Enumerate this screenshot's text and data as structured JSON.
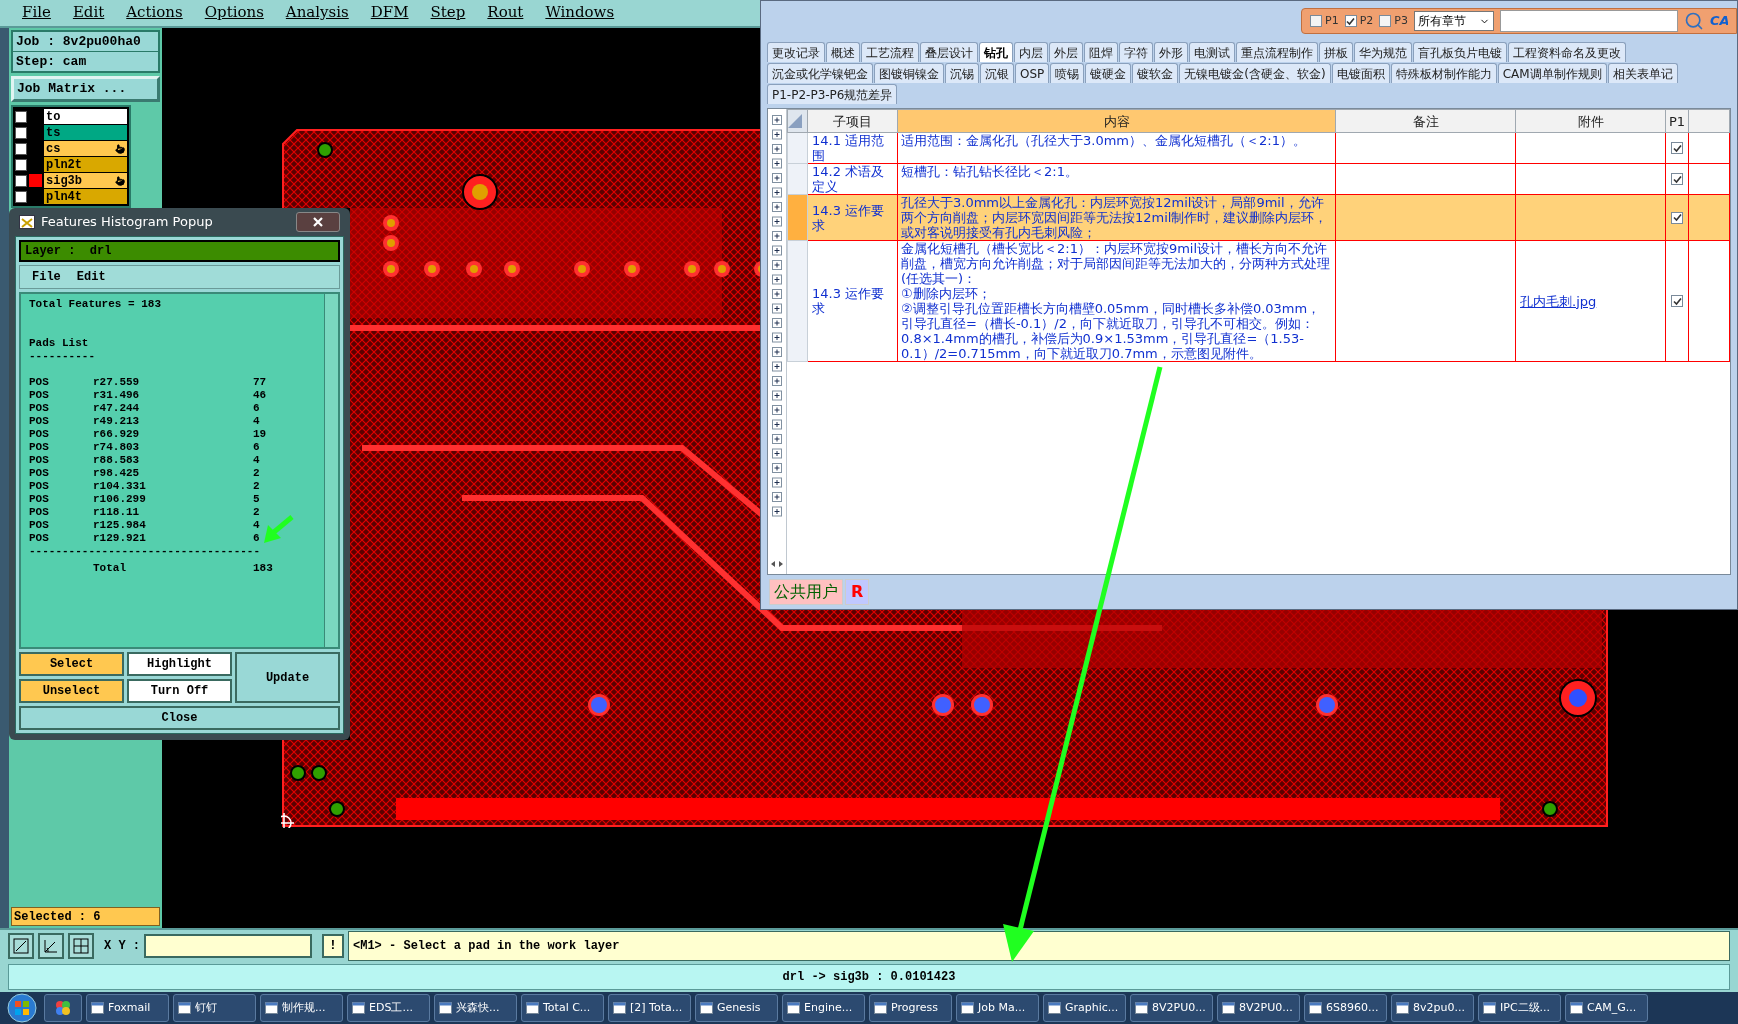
{
  "menu": [
    "File",
    "Edit",
    "Actions",
    "Options",
    "Analysis",
    "DFM",
    "Step",
    "Rout",
    "Windows"
  ],
  "job": {
    "job_label": "Job : 8v2pu00ha0",
    "step_label": "Step: cam",
    "matrix_button": "Job Matrix ..."
  },
  "layers": [
    {
      "name": "to",
      "color": "#ffffff",
      "checked": false,
      "work": false,
      "affected": false
    },
    {
      "name": "ts",
      "color": "#00a884",
      "checked": false,
      "work": false,
      "affected": false
    },
    {
      "name": "cs",
      "color": "#ffc850",
      "checked": false,
      "work": false,
      "affected": true
    },
    {
      "name": "pln2t",
      "color": "#d9a800",
      "checked": false,
      "work": false,
      "affected": false
    },
    {
      "name": "sig3b",
      "color": "#ffc850",
      "checked": false,
      "work": true,
      "affected": true
    },
    {
      "name": "pln4t",
      "color": "#d9a800",
      "checked": false,
      "work": false,
      "affected": false
    }
  ],
  "selected_label": "Selected : 6",
  "histogram": {
    "title": "Features Histogram Popup",
    "layer_label": "Layer :  drl",
    "menu": [
      "File",
      "Edit"
    ],
    "total_line": "Total Features = 183",
    "section": "Pads List",
    "underline": "----------",
    "pads": [
      {
        "polarity": "POS",
        "symbol": "r27.559",
        "count": "77"
      },
      {
        "polarity": "POS",
        "symbol": "r31.496",
        "count": "46"
      },
      {
        "polarity": "POS",
        "symbol": "r47.244",
        "count": "6"
      },
      {
        "polarity": "POS",
        "symbol": "r49.213",
        "count": "4"
      },
      {
        "polarity": "POS",
        "symbol": "r66.929",
        "count": "19"
      },
      {
        "polarity": "POS",
        "symbol": "r74.803",
        "count": "6"
      },
      {
        "polarity": "POS",
        "symbol": "r88.583",
        "count": "4"
      },
      {
        "polarity": "POS",
        "symbol": "r98.425",
        "count": "2"
      },
      {
        "polarity": "POS",
        "symbol": "r104.331",
        "count": "2"
      },
      {
        "polarity": "POS",
        "symbol": "r106.299",
        "count": "5"
      },
      {
        "polarity": "POS",
        "symbol": "r118.11",
        "count": "2"
      },
      {
        "polarity": "POS",
        "symbol": "r125.984",
        "count": "4"
      },
      {
        "polarity": "POS",
        "symbol": "r129.921",
        "count": "6"
      }
    ],
    "separator": "-----------------------------------",
    "total_label": "Total",
    "total_count": "183",
    "buttons": {
      "select": "Select",
      "unselect": "Unselect",
      "highlight": "Highlight",
      "turn_off": "Turn Off",
      "update": "Update",
      "close": "Close"
    }
  },
  "bottom": {
    "xy_label": "X Y :",
    "bang_button": "!",
    "message": "<M1> - Select a pad in the work layer",
    "status": "drl -> sig3b : 0.0101423"
  },
  "doc": {
    "filters": [
      {
        "label": "P1",
        "checked": false
      },
      {
        "label": "P2",
        "checked": true
      },
      {
        "label": "P3",
        "checked": false
      }
    ],
    "chapter_select": "所有章节",
    "logo_text": "CA",
    "tab_rows": [
      [
        {
          "label": "更改记录",
          "selected": false
        },
        {
          "label": "概述",
          "selected": false
        },
        {
          "label": "工艺流程",
          "selected": false
        },
        {
          "label": "叠层设计",
          "selected": false
        },
        {
          "label": "钻孔",
          "selected": true
        },
        {
          "label": "内层",
          "selected": false
        },
        {
          "label": "外层",
          "selected": false
        },
        {
          "label": "阻焊",
          "selected": false
        },
        {
          "label": "字符",
          "selected": false
        },
        {
          "label": "外形",
          "selected": false
        },
        {
          "label": "电测试",
          "selected": false
        },
        {
          "label": "重点流程制作",
          "selected": false
        },
        {
          "label": "拼板",
          "selected": false
        },
        {
          "label": "华为规范",
          "selected": false
        },
        {
          "label": "盲孔板负片电镀",
          "selected": false
        },
        {
          "label": "工程资料命名及更改",
          "selected": false
        }
      ],
      [
        {
          "label": "沉金或化学镍钯金",
          "selected": false
        },
        {
          "label": "图镀铜镍金",
          "selected": false
        },
        {
          "label": "沉锡",
          "selected": false
        },
        {
          "label": "沉银",
          "selected": false
        },
        {
          "label": "OSP",
          "selected": false
        },
        {
          "label": "喷锡",
          "selected": false
        },
        {
          "label": "镀硬金",
          "selected": false
        },
        {
          "label": "镀软金",
          "selected": false
        },
        {
          "label": "无镍电镀金(含硬金、软金)",
          "selected": false
        },
        {
          "label": "电镀面积",
          "selected": false
        },
        {
          "label": "特殊板材制作能力",
          "selected": false
        },
        {
          "label": "CAM调单制作规则",
          "selected": false
        },
        {
          "label": "相关表单记",
          "selected": false
        }
      ],
      [
        {
          "label": "P1-P2-P3-P6规范差异",
          "selected": false
        }
      ]
    ],
    "table": {
      "columns": [
        "子项目",
        "内容",
        "备注",
        "附件",
        "P1"
      ],
      "rows": [
        {
          "item": "14.1 适用范围",
          "content": "适用范围：金属化孔（孔径大于3.0mm）、金属化短槽孔（＜2:1）。",
          "attachment": null,
          "p1": true,
          "selected": false
        },
        {
          "item": "14.2 术语及定义",
          "content": "短槽孔：钻孔钻长径比＜2:1。",
          "attachment": null,
          "p1": true,
          "selected": false
        },
        {
          "item": "14.3 运作要求",
          "content": "孔径大于3.0mm以上金属化孔：内层环宽按12mil设计，局部9mil，允许两个方向削盘；内层环宽因间距等无法按12mil制作时，建议删除内层环，或对客说明接受有孔内毛刺风险；",
          "attachment": null,
          "p1": true,
          "selected": true
        },
        {
          "item": "14.3 运作要求",
          "content": "金属化短槽孔（槽长宽比＜2:1）：内层环宽按9mil设计，槽长方向不允许削盘，槽宽方向允许削盘；对于局部因间距等无法加大的，分两种方式处理(任选其一)：\n①删除内层环；\n②调整引导孔位置距槽长方向槽壁0.05mm，同时槽长多补偿0.03mm，引导孔直径=（槽长-0.1）/2，向下就近取刀，引导孔不可相交。例如：0.8×1.4mm的槽孔，补偿后为0.9×1.53mm，引导孔直径=（1.53-0.1）/2=0.715mm，向下就近取刀0.7mm，示意图见附件。",
          "attachment": "孔内毛刺.jpg",
          "p1": true,
          "selected": false
        }
      ]
    },
    "user": "公共用户",
    "role": "R"
  },
  "taskbar": [
    "Foxmail",
    "钉钉",
    "制作规...",
    "EDS工...",
    "兴森快...",
    "Total C...",
    "[2] Tota...",
    "Genesis",
    "Engine...",
    "Progress",
    "Job Ma...",
    "Graphic...",
    "8V2PU0...",
    "8V2PU0...",
    "6S8960...",
    "8v2pu0...",
    "IPC二级...",
    "CAM_G..."
  ]
}
